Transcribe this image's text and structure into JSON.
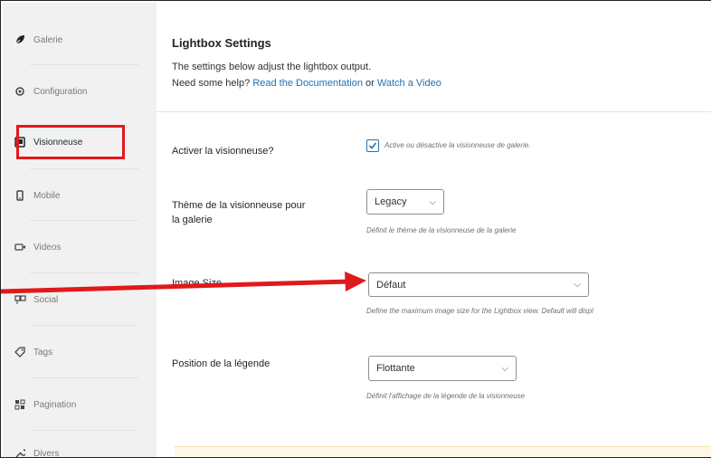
{
  "sidebar": {
    "items": [
      {
        "label": "Galerie",
        "icon": "leaf-icon"
      },
      {
        "label": "Configuration",
        "icon": "gear-icon"
      },
      {
        "label": "Visionneuse",
        "icon": "lightbox-icon"
      },
      {
        "label": "Mobile",
        "icon": "mobile-icon"
      },
      {
        "label": "Videos",
        "icon": "video-icon"
      },
      {
        "label": "Social",
        "icon": "social-icon"
      },
      {
        "label": "Tags",
        "icon": "tag-icon"
      },
      {
        "label": "Pagination",
        "icon": "pagination-icon"
      },
      {
        "label": "Divers",
        "icon": "wrench-icon"
      }
    ]
  },
  "main": {
    "title": "Lightbox Settings",
    "desc_line1": "The settings below adjust the lightbox output.",
    "desc_prefix": "Need some help?",
    "doc_link": "Read the Documentation",
    "or_text": "or",
    "video_link": "Watch a Video"
  },
  "settings": {
    "enable": {
      "label": "Activer la visionneuse?",
      "help": "Active ou désactive la visionneuse de galerie.",
      "checked": true
    },
    "theme": {
      "label_line1": "Thème de la visionneuse pour",
      "label_line2": "la galerie",
      "value": "Legacy",
      "help": "Définit le thème de la visionneuse de la galerie"
    },
    "image_size": {
      "label": "Image Size",
      "value": "Défaut",
      "help": "Define the maximum image size for the Lightbox view. Default will displ"
    },
    "caption": {
      "label": "Position de la légende",
      "value": "Flottante",
      "help": "Définit l'affichage de la légende de la visionneuse"
    }
  },
  "colors": {
    "accent": "#2271b1",
    "highlight": "#e0191c",
    "arrow": "#e0191c"
  }
}
